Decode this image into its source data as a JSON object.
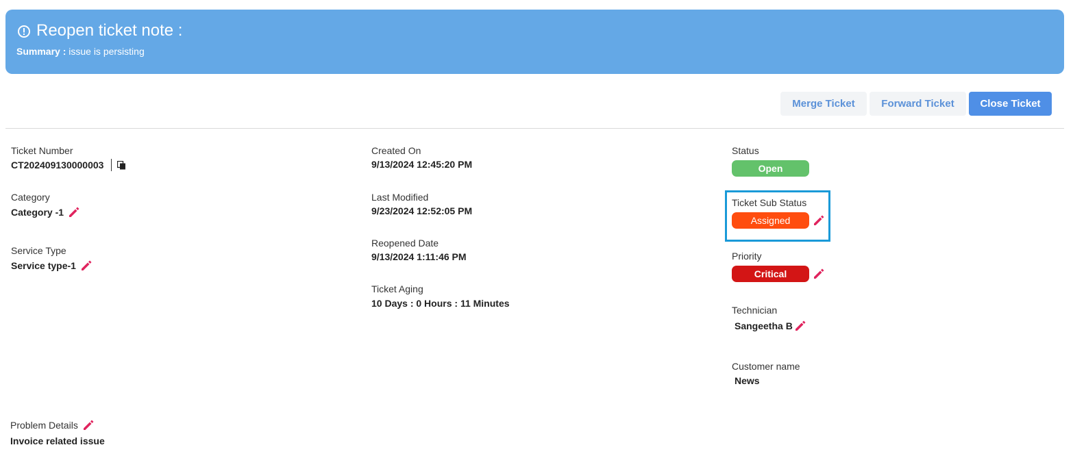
{
  "banner": {
    "title": "Reopen ticket note :",
    "summary_label": "Summary :",
    "summary_text": "issue is persisting",
    "icon": "info-circle-icon",
    "color": "#64a8e6"
  },
  "actions": {
    "merge": "Merge Ticket",
    "forward": "Forward Ticket",
    "close": "Close Ticket"
  },
  "left": {
    "ticket_number_label": "Ticket Number",
    "ticket_number": "CT202409130000003",
    "category_label": "Category",
    "category": "Category -1",
    "service_type_label": "Service Type",
    "service_type": "Service type-1",
    "problem_details_label": "Problem Details",
    "problem_details": "Invoice related issue"
  },
  "middle": {
    "created_on_label": "Created On",
    "created_on": "9/13/2024 12:45:20 PM",
    "last_modified_label": "Last Modified",
    "last_modified": "9/23/2024 12:52:05 PM",
    "reopened_date_label": "Reopened Date",
    "reopened_date": "9/13/2024 1:11:46 PM",
    "ticket_aging_label": "Ticket Aging",
    "ticket_aging": "10 Days : 0 Hours : 11 Minutes"
  },
  "right": {
    "status_label": "Status",
    "status": "Open",
    "sub_status_label": "Ticket Sub Status",
    "sub_status": "Assigned",
    "priority_label": "Priority",
    "priority": "Critical",
    "technician_label": "Technician",
    "technician": "Sangeetha B",
    "customer_label": "Customer name",
    "customer": "News"
  },
  "colors": {
    "open": "#63c26b",
    "assigned": "#ff4d0f",
    "critical": "#d31515",
    "edit_icon": "#e0245e",
    "highlight": "#1a9ad8"
  }
}
